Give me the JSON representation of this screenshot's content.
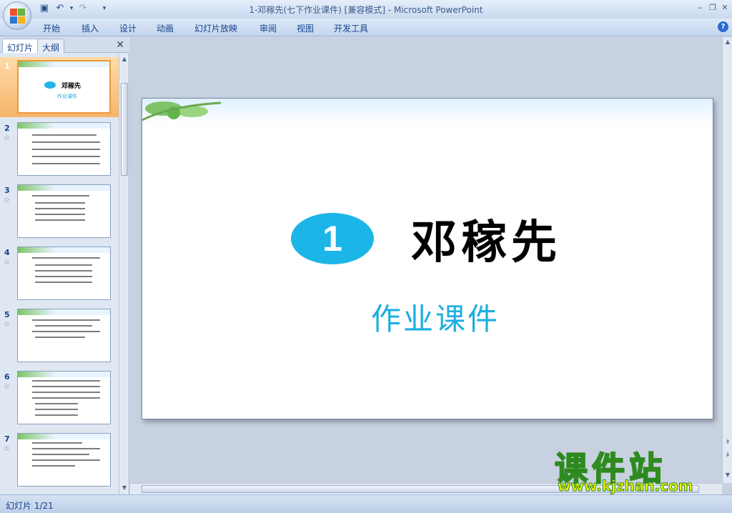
{
  "window": {
    "title": "1-邓稼先(七下作业课件) [兼容模式] - Microsoft PowerPoint",
    "qa_icons": [
      "save-icon",
      "undo-icon",
      "redo-icon",
      "customize-icon"
    ]
  },
  "ribbon": {
    "tabs": [
      "开始",
      "插入",
      "设计",
      "动画",
      "幻灯片放映",
      "审阅",
      "视图",
      "开发工具"
    ]
  },
  "leftpane": {
    "tabs": [
      "幻灯片",
      "大纲"
    ],
    "thumbs": [
      {
        "num": "1",
        "title": "邓稼先",
        "sub": "作业课件"
      },
      {
        "num": "2"
      },
      {
        "num": "3"
      },
      {
        "num": "4"
      },
      {
        "num": "5"
      },
      {
        "num": "6"
      },
      {
        "num": "7"
      }
    ]
  },
  "slide": {
    "number": "1",
    "title": "邓稼先",
    "subtitle": "作业课件"
  },
  "status": {
    "slide_info": "幻灯片 1/21"
  },
  "watermark": {
    "name": "课件站",
    "url": "www.kjzhan.com"
  }
}
